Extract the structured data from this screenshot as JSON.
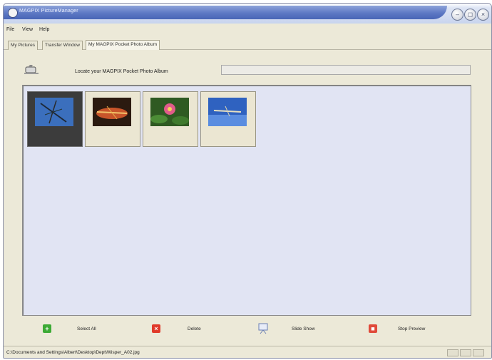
{
  "window": {
    "title": "MAGPIX PictureManager",
    "controls": [
      "minimize",
      "restore",
      "close"
    ]
  },
  "menu": {
    "items": [
      "File",
      "View",
      "Help"
    ]
  },
  "tabs": [
    {
      "label": "My Pictures",
      "active": false
    },
    {
      "label": "Transfer Window",
      "active": false
    },
    {
      "label": "My MAGPIX Pocket Photo Album",
      "active": true
    }
  ],
  "album": {
    "locate_label": "Locate your MAGPIX Pocket Photo Album",
    "path_value": ""
  },
  "thumbnails": [
    {
      "subject": "dragonfly on blue",
      "selected": true
    },
    {
      "subject": "dragonfly on orange",
      "selected": false
    },
    {
      "subject": "pink water lily",
      "selected": false
    },
    {
      "subject": "dragonfly on blue sky",
      "selected": false
    }
  ],
  "actions": [
    {
      "label": "Select All",
      "icon": "select-all-icon",
      "color": "#3daa35"
    },
    {
      "label": "Delete",
      "icon": "delete-icon",
      "color": "#e03a2a"
    },
    {
      "label": "Slide Show",
      "icon": "slide-show-icon",
      "color": "#6a7fb5"
    },
    {
      "label": "Stop Preview",
      "icon": "stop-preview-icon",
      "color": "#e04a3a"
    }
  ],
  "status": {
    "path": "C:\\Documents and Settings\\Albert\\Desktop\\Dept\\Wisper_A02.jpg"
  }
}
